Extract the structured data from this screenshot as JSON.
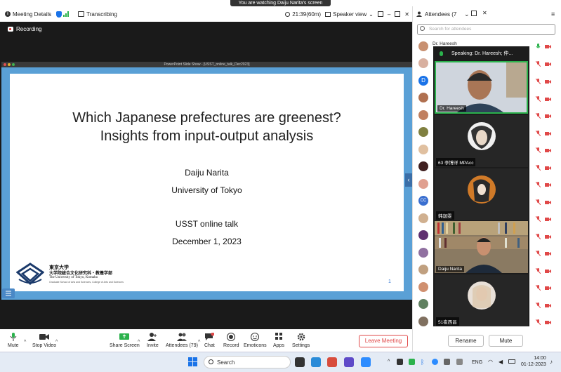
{
  "banner": "You are watching Daiju Narita's screen",
  "topbar": {
    "meeting_details": "Meeting Details",
    "transcribing": "Transcribing",
    "timer": "21:39(60m)",
    "speaker_view": "Speaker view"
  },
  "recording": "Recording",
  "ppt_title": "PowerPoint Slide Show - [USST_online_talk_Dec2023]",
  "slide": {
    "title_line1": "Which Japanese prefectures are greenest?",
    "title_line2": "Insights from input-output analysis",
    "author": "Daiju Narita",
    "affiliation": "University of Tokyo",
    "event": "USST online talk",
    "date": "December 1, 2023",
    "logo_jp1": "東京大学",
    "logo_jp2": "大学院総合文化研究科・教養学部",
    "logo_en": "The University of Tokyo, Komaba",
    "logo_en2": "Graduate School of Arts and Sciences, College of Arts and Sciences",
    "page": "1"
  },
  "toolbar": {
    "mute": "Mute",
    "stop_video": "Stop Video",
    "share_screen": "Share Screen",
    "invite": "Invite",
    "attendees": "Attendees (79)",
    "chat": "Chat",
    "record": "Record",
    "emoticons": "Emoticons",
    "apps": "Apps",
    "settings": "Settings",
    "leave": "Leave Meeting"
  },
  "panel": {
    "title": "Attendees (7",
    "search_placeholder": "Search for attendees",
    "first_attendee": "Dr. Hareesh",
    "speaking": "Speaking:  Dr. Hareesh; 仲...",
    "tiles": [
      "Dr. Hareesh",
      "63 李博洋 MPAcc",
      "韩迦雯",
      "Daiju Narita",
      "51崔西昌"
    ],
    "rename": "Rename",
    "mute": "Mute"
  },
  "taskbar": {
    "search": "Search",
    "lang": "ENG",
    "time": "14:00",
    "date": "01-12-2023"
  },
  "colors": {
    "accent_blue": "#1a73e8",
    "mic_green": "#2bb24c",
    "leave_red": "#e04848",
    "slide_frame": "#5aa0d6"
  }
}
